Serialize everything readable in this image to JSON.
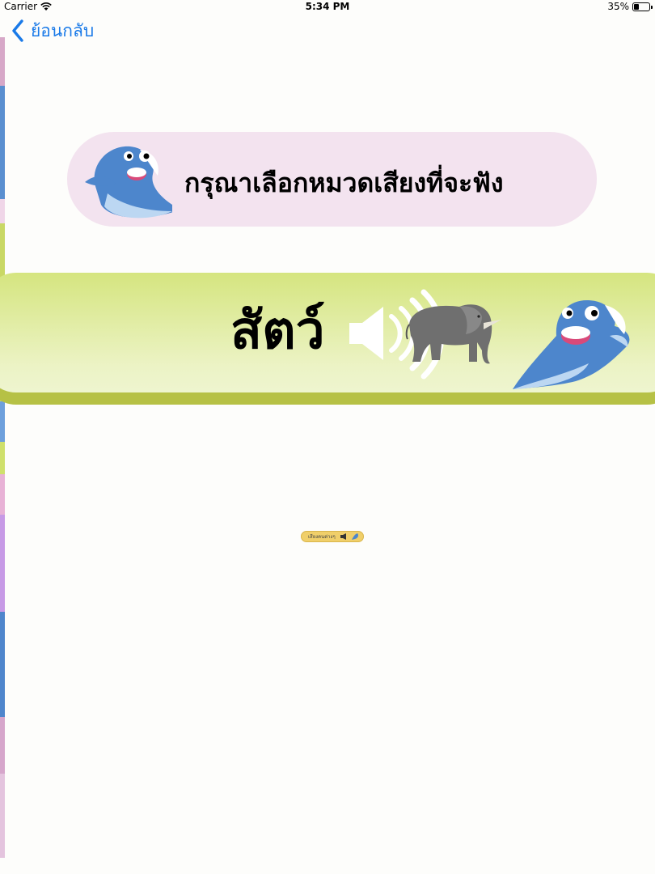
{
  "status_bar": {
    "carrier": "Carrier",
    "time": "5:34 PM",
    "battery_percent": "35%",
    "battery_level": 0.35
  },
  "nav": {
    "back_label": "ย้อนกลับ"
  },
  "header": {
    "title": "กรุณาเลือกหมวดเสียงที่จะฟัง"
  },
  "categories": [
    {
      "label": "สัตว์",
      "icons": [
        "speaker-icon",
        "elephant-icon",
        "dolphin-mascot-icon"
      ]
    }
  ],
  "thumbnail": {
    "label": "เสียงคนต่างๆ"
  },
  "colors": {
    "accent": "#1a7ae8",
    "header_bg": "#f3e3ef",
    "category_top": "#d5e57f",
    "category_shadow": "#b6c145"
  }
}
